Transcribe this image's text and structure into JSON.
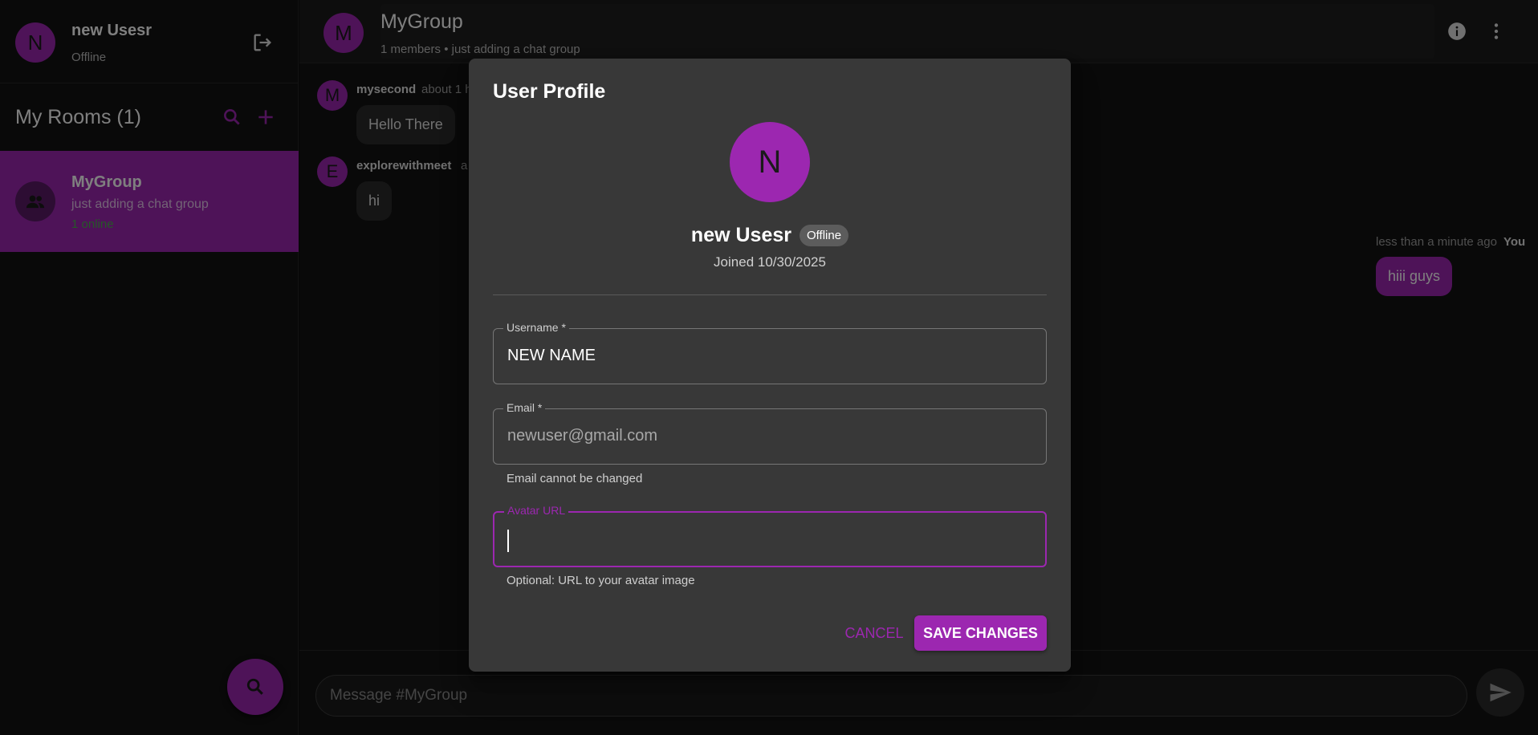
{
  "user": {
    "avatar_initial": "N",
    "name": "new Usesr",
    "status": "Offline"
  },
  "rooms": {
    "title": "My Rooms (1)",
    "items": [
      {
        "name": "MyGroup",
        "description": "just adding a chat group",
        "online": "1 online",
        "icon": "group-icon"
      }
    ]
  },
  "chat": {
    "avatar_initial": "M",
    "title": "MyGroup",
    "subtitle": "1 members • just adding a chat group",
    "messages": [
      {
        "avatar_initial": "M",
        "author": "mysecond",
        "time": "about 1 h",
        "text": "Hello There"
      },
      {
        "avatar_initial": "E",
        "author": "explorewithmeet",
        "time": "a",
        "text": "hi"
      },
      {
        "author": "You",
        "time": "less than a minute ago",
        "text": "hiii guys"
      }
    ],
    "input_placeholder": "Message #MyGroup"
  },
  "dialog": {
    "title": "User Profile",
    "avatar_initial": "N",
    "name": "new Usesr",
    "status_chip": "Offline",
    "joined": "Joined 10/30/2025",
    "fields": {
      "username": {
        "label": "Username *",
        "value": "NEW NAME"
      },
      "email": {
        "label": "Email *",
        "value": "newuser@gmail.com",
        "helper": "Email cannot be changed"
      },
      "avatar_url": {
        "label": "Avatar URL",
        "value": "",
        "helper": "Optional: URL to your avatar image"
      }
    },
    "cancel_label": "CANCEL",
    "save_label": "SAVE CHANGES"
  },
  "colors": {
    "accent": "#9c27b0",
    "background": "#121212",
    "dialog_bg": "#383838",
    "online": "#4caf50"
  }
}
